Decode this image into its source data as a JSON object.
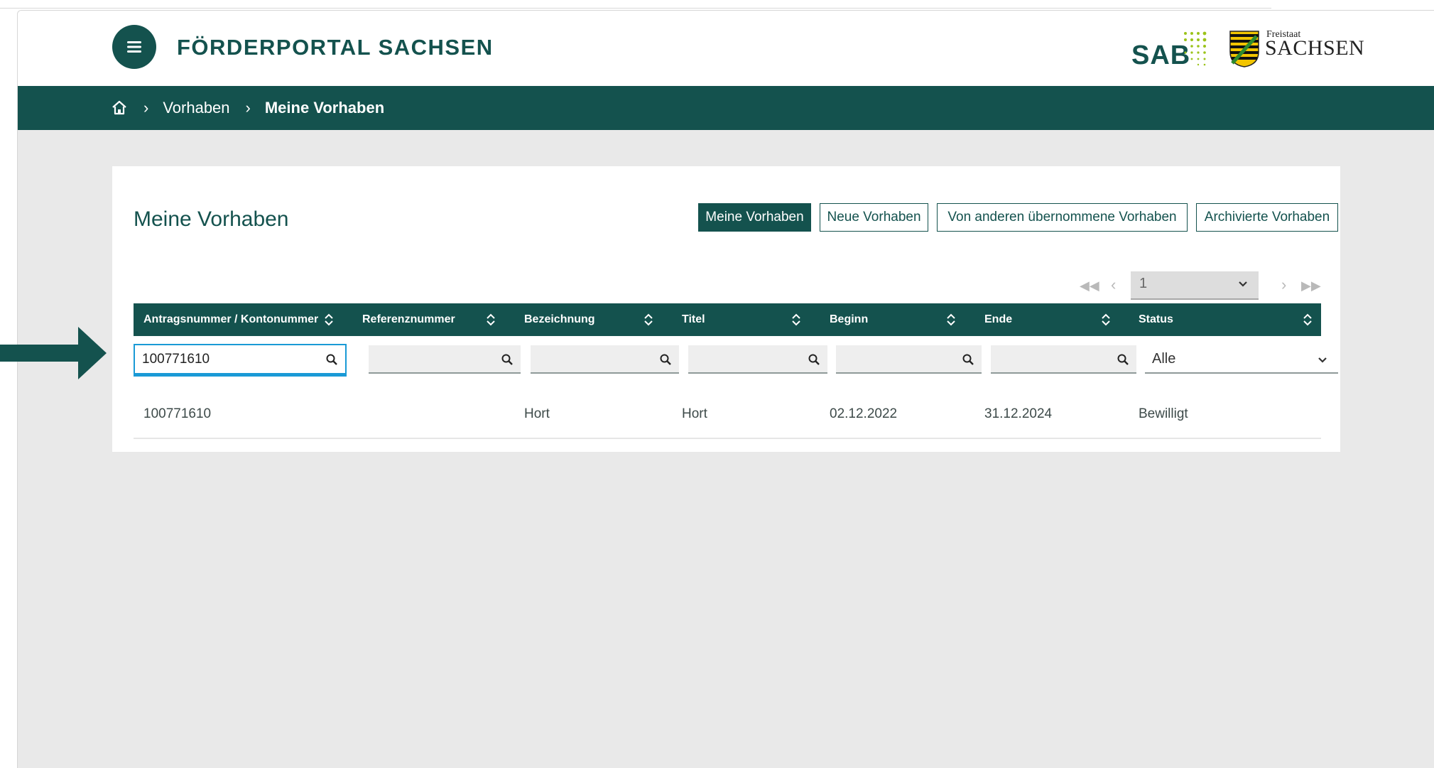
{
  "header": {
    "portal_title": "FÖRDERPORTAL SACHSEN",
    "sab_logo_text": "SAB",
    "sachsen_logo_small": "Freistaat",
    "sachsen_logo_big": "SACHSEN"
  },
  "breadcrumb": {
    "items": [
      "Vorhaben",
      "Meine Vorhaben"
    ]
  },
  "page": {
    "title": "Meine Vorhaben",
    "tabs": [
      {
        "label": "Meine Vorhaben",
        "active": true
      },
      {
        "label": "Neue Vorhaben",
        "active": false
      },
      {
        "label": "Von anderen übernommene Vorhaben",
        "active": false
      },
      {
        "label": "Archivierte Vorhaben",
        "active": false
      }
    ]
  },
  "pager": {
    "current_page": "1"
  },
  "table": {
    "columns": [
      "Antragsnummer / Kontonummer",
      "Referenznummer",
      "Bezeichnung",
      "Titel",
      "Beginn",
      "Ende",
      "Status"
    ],
    "filters": {
      "antragsnummer": "100771610",
      "status": "Alle"
    },
    "rows": [
      [
        "100771610",
        "",
        "Hort",
        "Hort",
        "02.12.2022",
        "31.12.2024",
        "Bewilligt"
      ]
    ]
  },
  "colors": {
    "brand": "#14524e",
    "focus": "#1a9ad6",
    "sab_green": "#9bc31a"
  }
}
